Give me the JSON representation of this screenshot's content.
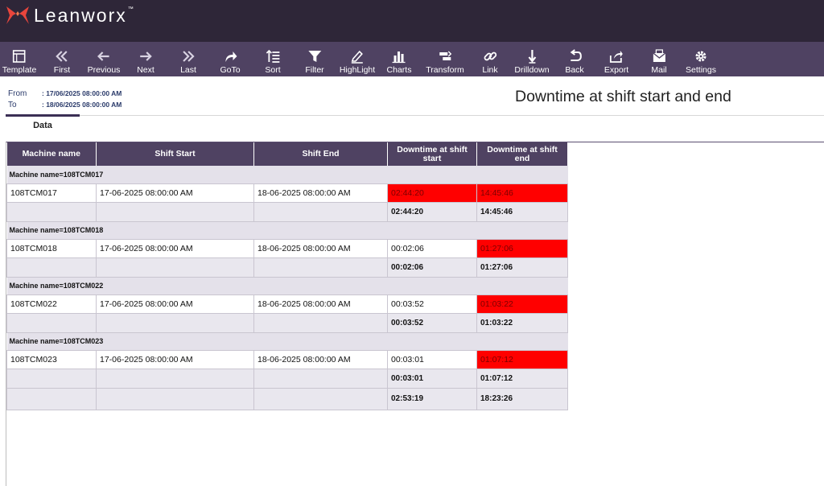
{
  "app": {
    "brand": "Leanworx",
    "trademark": "™"
  },
  "toolbar": [
    {
      "label": "Template",
      "icon": "template-icon"
    },
    {
      "label": "First",
      "icon": "double-arrow-left-icon"
    },
    {
      "label": "Previous",
      "icon": "arrow-left-icon"
    },
    {
      "label": "Next",
      "icon": "arrow-right-icon"
    },
    {
      "label": "Last",
      "icon": "double-arrow-right-icon"
    },
    {
      "label": "GoTo",
      "icon": "goto-icon"
    },
    {
      "label": "Sort",
      "icon": "sort-icon"
    },
    {
      "label": "Filter",
      "icon": "filter-icon"
    },
    {
      "label": "HighLight",
      "icon": "highlight-icon"
    },
    {
      "label": "Charts",
      "icon": "bar-chart-icon"
    },
    {
      "label": "Transform",
      "icon": "transform-icon"
    },
    {
      "label": "Link",
      "icon": "link-icon"
    },
    {
      "label": "Drilldown",
      "icon": "drilldown-icon"
    },
    {
      "label": "Back",
      "icon": "back-icon"
    },
    {
      "label": "Export",
      "icon": "export-icon"
    },
    {
      "label": "Mail",
      "icon": "mail-icon"
    },
    {
      "label": "Settings",
      "icon": "gear-icon"
    }
  ],
  "daterange": {
    "from_label": "From",
    "from_value": ": 17/06/2025 08:00:00 AM",
    "to_label": "To",
    "to_value": ": 18/06/2025 08:00:00 AM"
  },
  "report": {
    "title": "Downtime at shift start and end"
  },
  "tabs": [
    {
      "label": "Data"
    }
  ],
  "table": {
    "columns": [
      "Machine name",
      "Shift Start",
      "Shift End",
      "Downtime at shift start",
      "Downtime at shift end"
    ],
    "groups": [
      {
        "header": "Machine name=108TCM017",
        "row": {
          "machine": "108TCM017",
          "start": "17-06-2025 08:00:00 AM",
          "end": "18-06-2025 08:00:00 AM",
          "dt_start": "02:44:20",
          "dt_end": "14:45:46"
        },
        "subtotal": {
          "dt_start": "02:44:20",
          "dt_end": "14:45:46"
        }
      },
      {
        "header": "Machine name=108TCM018",
        "row": {
          "machine": "108TCM018",
          "start": "17-06-2025 08:00:00 AM",
          "end": "18-06-2025 08:00:00 AM",
          "dt_start": "00:02:06",
          "dt_end": "01:27:06"
        },
        "subtotal": {
          "dt_start": "00:02:06",
          "dt_end": "01:27:06"
        }
      },
      {
        "header": "Machine name=108TCM022",
        "row": {
          "machine": "108TCM022",
          "start": "17-06-2025 08:00:00 AM",
          "end": "18-06-2025 08:00:00 AM",
          "dt_start": "00:03:52",
          "dt_end": "01:03:22"
        },
        "subtotal": {
          "dt_start": "00:03:52",
          "dt_end": "01:03:22"
        }
      },
      {
        "header": "Machine name=108TCM023",
        "row": {
          "machine": "108TCM023",
          "start": "17-06-2025 08:00:00 AM",
          "end": "18-06-2025 08:00:00 AM",
          "dt_start": "00:03:01",
          "dt_end": "01:07:12"
        },
        "subtotal": {
          "dt_start": "00:03:01",
          "dt_end": "01:07:12"
        }
      }
    ],
    "total": {
      "dt_start": "02:53:19",
      "dt_end": "18:23:26"
    }
  },
  "colors": {
    "header_bg": "#2e2638",
    "toolbar_bg": "#4f4262",
    "highlight": "#ff0000"
  }
}
